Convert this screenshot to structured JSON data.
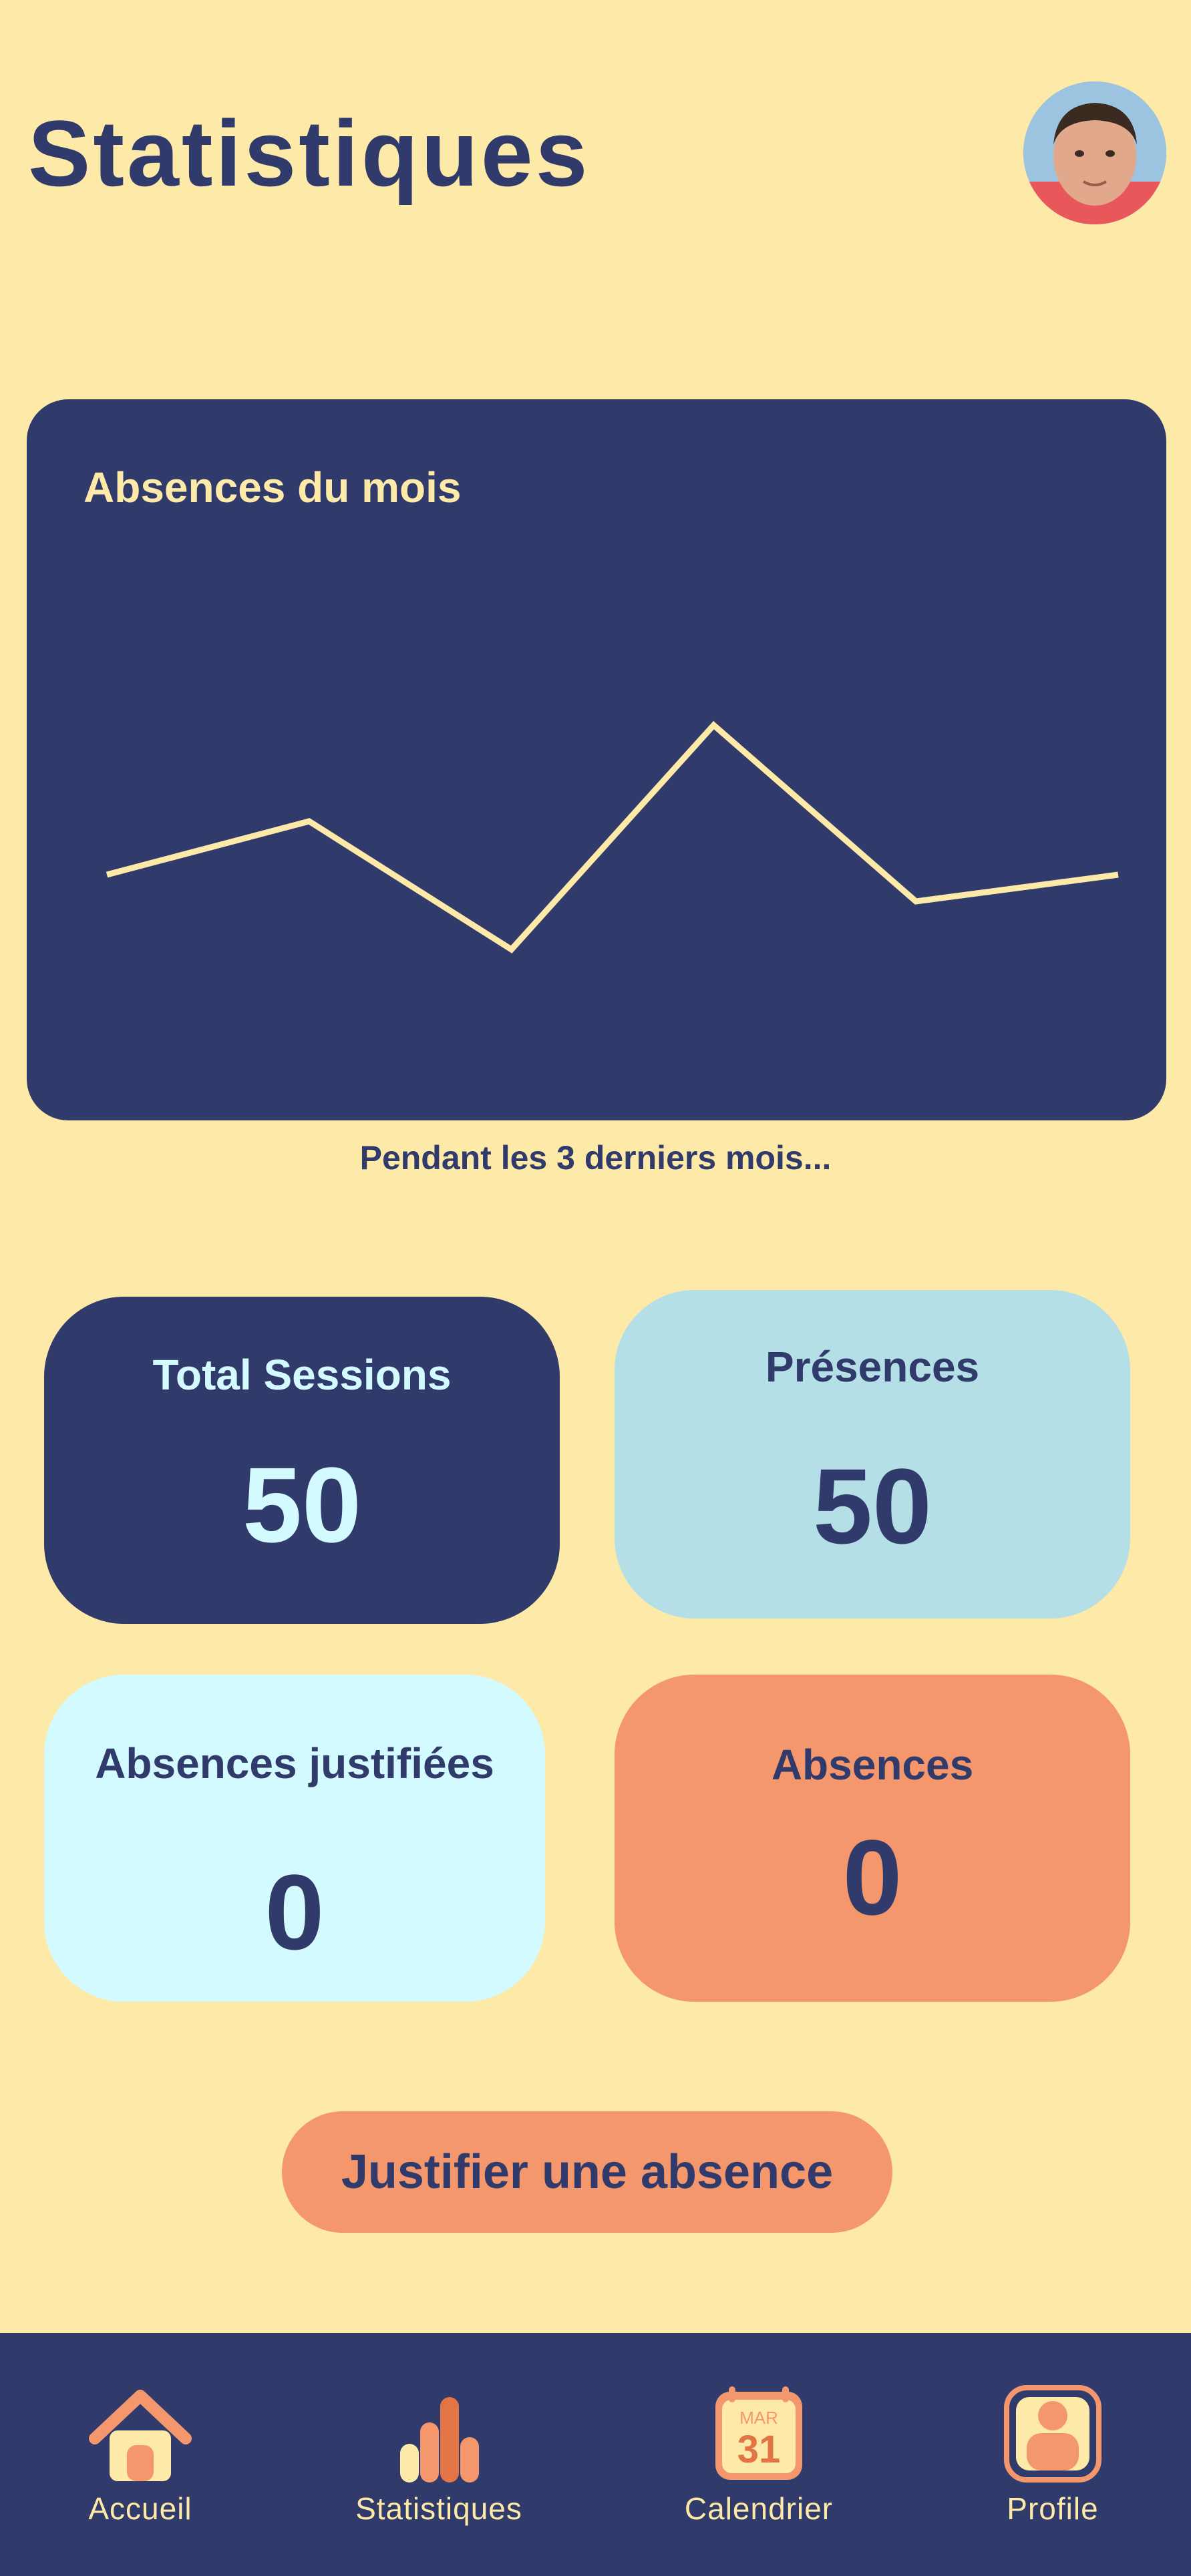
{
  "header": {
    "title": "Statistiques",
    "avatar_icon": "user-photo"
  },
  "chart_data": {
    "type": "line",
    "title": "Absences du mois",
    "x": [
      1,
      2,
      3,
      4,
      5,
      6
    ],
    "values": [
      0.36,
      0.46,
      0.22,
      0.64,
      0.31,
      0.36
    ],
    "ylim": [
      0,
      1
    ],
    "grid": false,
    "line_color": "#FDE9A8"
  },
  "chart_caption": "Pendant les 3 derniers mois...",
  "stats": {
    "total": {
      "label": "Total Sessions",
      "value": "50"
    },
    "presences": {
      "label": "Présences",
      "value": "50"
    },
    "justified": {
      "label": "Absences justifiées",
      "value": "0"
    },
    "absences": {
      "label": "Absences",
      "value": "0"
    }
  },
  "action": {
    "justify_label": "Justifier une absence"
  },
  "calendar_icon": {
    "month": "MAR",
    "day": "31"
  },
  "nav": {
    "home": "Accueil",
    "stats": "Statistiques",
    "calendar": "Calendrier",
    "profile": "Profile"
  },
  "colors": {
    "background": "#FDE9A8",
    "navy": "#303B6B",
    "orange": "#F4976C",
    "light_blue": "#B4DFE7",
    "pale_cyan": "#D3FBFF"
  }
}
